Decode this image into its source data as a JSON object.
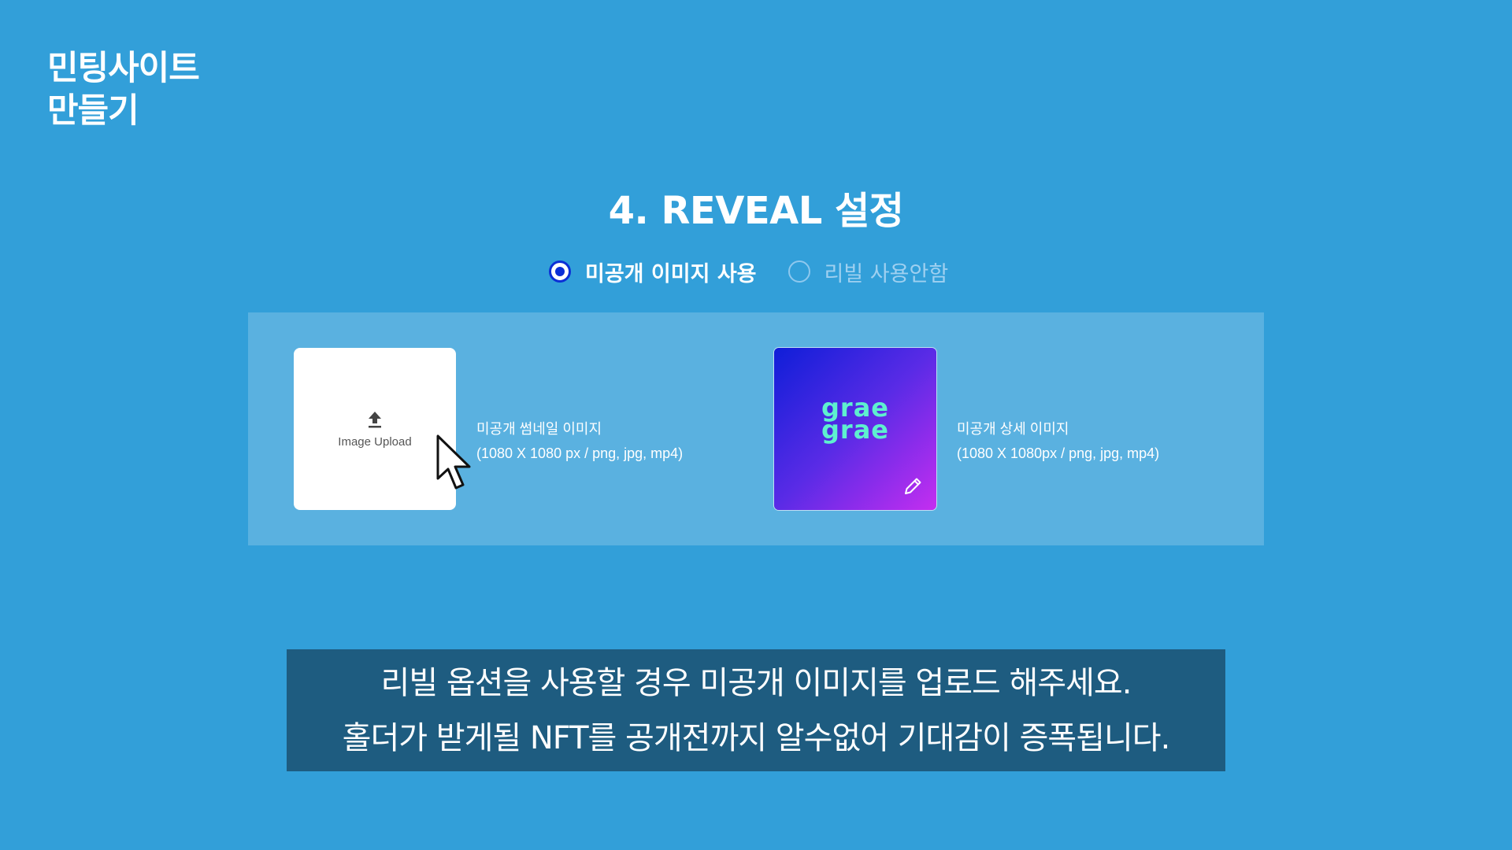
{
  "brand": {
    "line1": "민팅사이트",
    "line2": "만들기"
  },
  "section_title": "4. REVEAL 설정",
  "radio": {
    "options": [
      {
        "label": "미공개 이미지 사용",
        "checked": true
      },
      {
        "label": "리빌 사용안함",
        "checked": false
      }
    ]
  },
  "upload": {
    "label": "Image Upload",
    "icon": "upload-icon"
  },
  "thumbnail_caption": {
    "title": "미공개 썸네일 이미지",
    "spec": "(1080 X 1080 px / png, jpg, mp4)"
  },
  "preview": {
    "logo_line1": "grae",
    "logo_line2": "grae",
    "edit_icon": "pencil-icon"
  },
  "detail_caption": {
    "title": "미공개 상세 이미지",
    "spec": "(1080 X 1080px / png, jpg, mp4)"
  },
  "notice": {
    "line1": "리빌 옵션을 사용할 경우 미공개 이미지를 업로드 해주세요.",
    "line2": "홀더가 받게될 NFT를 공개전까지 알수없어 기대감이 증폭됩니다."
  },
  "colors": {
    "background": "#329fd9",
    "panel": "#5ab1e0",
    "radio_accent": "#0b2fd6",
    "notice_bg": "#1e5c80",
    "logo_teal": "#5ef0cf"
  }
}
